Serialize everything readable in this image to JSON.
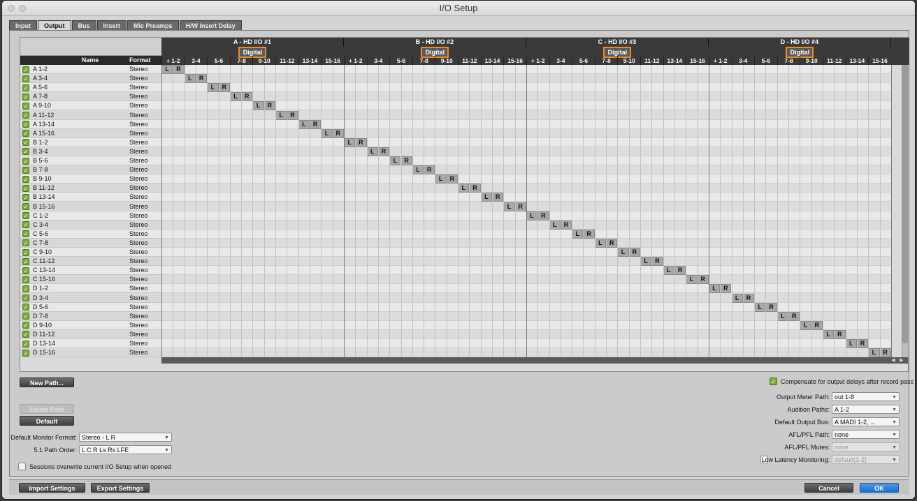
{
  "window": {
    "title": "I/O Setup"
  },
  "tabs": [
    {
      "label": "Input",
      "active": false
    },
    {
      "label": "Output",
      "active": true
    },
    {
      "label": "Bus",
      "active": false
    },
    {
      "label": "Insert",
      "active": false
    },
    {
      "label": "Mic Preamps",
      "active": false
    },
    {
      "label": "H/W Insert Delay",
      "active": false
    }
  ],
  "grid": {
    "col_headers": {
      "name": "Name",
      "format": "Format"
    },
    "devices": [
      {
        "name": "A - HD I/O #1",
        "type": "Digital"
      },
      {
        "name": "B - HD I/O #2",
        "type": "Digital"
      },
      {
        "name": "C - HD I/O #3",
        "type": "Digital"
      },
      {
        "name": "D - HD I/O #4",
        "type": "Digital"
      }
    ],
    "channel_pairs": [
      "+ 1-2",
      "3-4",
      "5-6",
      "7-8",
      "9-10",
      "11-12",
      "13-14",
      "15-16"
    ],
    "assign_labels": [
      "L",
      "R"
    ],
    "paths": [
      {
        "name": "A 1-2",
        "format": "Stereo"
      },
      {
        "name": "A 3-4",
        "format": "Stereo"
      },
      {
        "name": "A 5-6",
        "format": "Stereo"
      },
      {
        "name": "A 7-8",
        "format": "Stereo"
      },
      {
        "name": "A 9-10",
        "format": "Stereo"
      },
      {
        "name": "A 11-12",
        "format": "Stereo"
      },
      {
        "name": "A 13-14",
        "format": "Stereo"
      },
      {
        "name": "A 15-16",
        "format": "Stereo"
      },
      {
        "name": "B 1-2",
        "format": "Stereo"
      },
      {
        "name": "B 3-4",
        "format": "Stereo"
      },
      {
        "name": "B 5-6",
        "format": "Stereo"
      },
      {
        "name": "B 7-8",
        "format": "Stereo"
      },
      {
        "name": "B 9-10",
        "format": "Stereo"
      },
      {
        "name": "B 11-12",
        "format": "Stereo"
      },
      {
        "name": "B 13-14",
        "format": "Stereo"
      },
      {
        "name": "B 15-16",
        "format": "Stereo"
      },
      {
        "name": "C 1-2",
        "format": "Stereo"
      },
      {
        "name": "C 3-4",
        "format": "Stereo"
      },
      {
        "name": "C 5-6",
        "format": "Stereo"
      },
      {
        "name": "C 7-8",
        "format": "Stereo"
      },
      {
        "name": "C 9-10",
        "format": "Stereo"
      },
      {
        "name": "C 11-12",
        "format": "Stereo"
      },
      {
        "name": "C 13-14",
        "format": "Stereo"
      },
      {
        "name": "C 15-16",
        "format": "Stereo"
      },
      {
        "name": "D 1-2",
        "format": "Stereo"
      },
      {
        "name": "D 3-4",
        "format": "Stereo"
      },
      {
        "name": "D 5-6",
        "format": "Stereo"
      },
      {
        "name": "D 7-8",
        "format": "Stereo"
      },
      {
        "name": "D 9-10",
        "format": "Stereo"
      },
      {
        "name": "D 11-12",
        "format": "Stereo"
      },
      {
        "name": "D 13-14",
        "format": "Stereo"
      },
      {
        "name": "D 15-16",
        "format": "Stereo"
      }
    ],
    "highlight_color": "#f08a1c",
    "checkbox_color": "#7ea937"
  },
  "left_controls": {
    "new_path": "New Path...",
    "delete_path": "Delete Path",
    "default": "Default",
    "monitor_format_label": "Default Monitor Format:",
    "monitor_format_value": "Stereo - L R",
    "path_order_label": "5.1 Path Order:",
    "path_order_value": "L C R Ls Rs LFE",
    "overwrite_label": "Sessions overwrite current I/O Setup when opened"
  },
  "right_controls": {
    "compensate_label": "Compensate for output delays after record pass",
    "output_meter_label": "Output Meter Path:",
    "output_meter_value": "out 1-8",
    "audition_label": "Audition Paths:",
    "audition_value": "A 1-2",
    "default_bus_label": "Default Output Bus:",
    "default_bus_value": "A MADI 1-2, ...",
    "afl_path_label": "AFL/PFL Path:",
    "afl_path_value": "none",
    "afl_mutes_label": "AFL/PFL Mutes:",
    "afl_mutes_value": "none",
    "low_latency_label": "Low Latency Monitoring:",
    "low_latency_value": "default(1-2)"
  },
  "footer": {
    "import": "Import Settings",
    "export": "Export Settings",
    "cancel": "Cancel",
    "ok": "OK"
  }
}
